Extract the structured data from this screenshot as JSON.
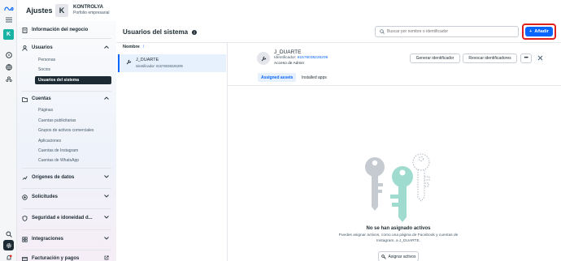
{
  "rail": {
    "logo_icon": "meta-logo-icon",
    "account_initial": "K"
  },
  "header": {
    "title": "Ajustes",
    "account_initial": "K",
    "account_name": "KONTROLYA",
    "account_type": "Porfolio empresarial"
  },
  "sidebar": {
    "business_info": "Información del negocio",
    "users": {
      "label": "Usuarios",
      "items": [
        "Personas",
        "Socios",
        "Usuarios del sistema"
      ],
      "active_index": 2
    },
    "accounts": {
      "label": "Cuentas",
      "items": [
        "Páginas",
        "Cuentas publicitarias",
        "Grupos de activos comerciales",
        "Aplicaciones",
        "Cuentas de Instagram",
        "Cuentas de WhatsApp"
      ]
    },
    "sections": [
      "Orígenes de datos",
      "Solicitudes",
      "Seguridad e idoneidad d...",
      "Integraciones",
      "Facturación y pagos"
    ]
  },
  "main": {
    "title": "Usuarios del sistema",
    "search_placeholder": "Buscar por nombre o identificador",
    "add_button": "Añadir",
    "list_header": "Nombre",
    "list_items": [
      {
        "name": "J_DUARTE",
        "id_text": "Identificador: 61576038226209"
      }
    ],
    "detail": {
      "name": "J_DUARTE",
      "id_label": "Identificador: ",
      "id_value": "61576038226209",
      "access": "Acceso de Admin",
      "generate_button": "Generar identificador",
      "revoke_button": "Revocar identificadores",
      "tabs": [
        "Assigned assets",
        "Installed apps"
      ],
      "active_tab": 0,
      "empty_title": "No se han asignado activos",
      "empty_desc": "Puedes asignar activos, como una página de Facebook y cuentas de Instagram, a J_DUARTE.",
      "assign_button": "Asignar activos"
    }
  },
  "colors": {
    "accent": "#0866ff",
    "highlight_border": "#e0201c",
    "active_nav": "#1c2b33",
    "key_gray": "#c6cbd2",
    "key_teal": "#9fdccf"
  }
}
